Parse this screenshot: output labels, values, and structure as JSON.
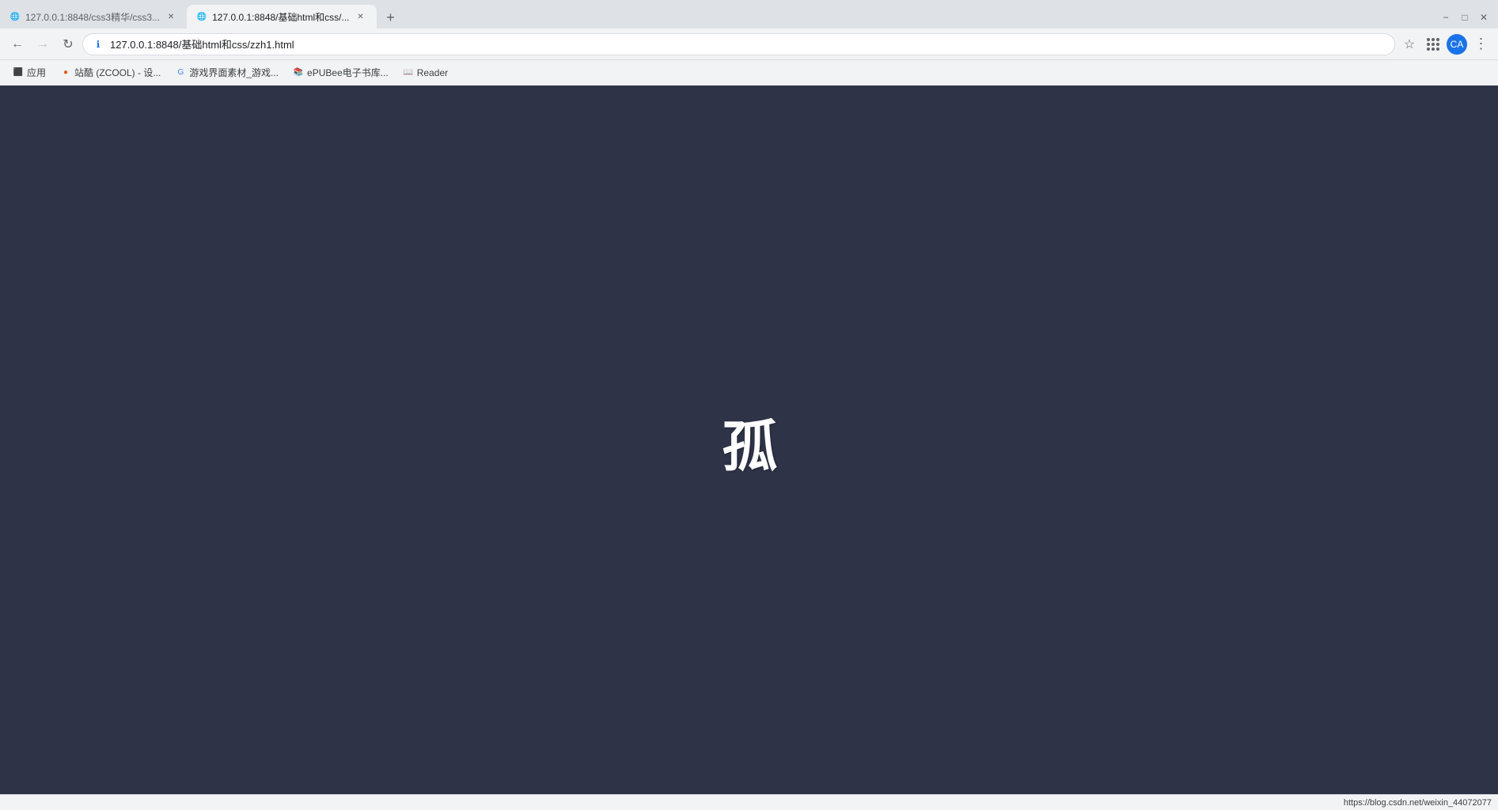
{
  "browser": {
    "tabs": [
      {
        "id": "tab1",
        "title": "127.0.0.1:8848/css3精华/css3...",
        "favicon": "🌐",
        "active": false,
        "url": "127.0.0.1:8848/css3精华/css3"
      },
      {
        "id": "tab2",
        "title": "127.0.0.1:8848/基础html和css/...",
        "favicon": "🌐",
        "active": true,
        "url": "127.0.0.1:8848/基础html和css/zzh1.html"
      }
    ],
    "new_tab_label": "+",
    "window_controls": {
      "minimize": "−",
      "maximize": "□",
      "close": "✕"
    }
  },
  "navbar": {
    "back_disabled": false,
    "forward_disabled": true,
    "reload_label": "↻",
    "address": "127.0.0.1:8848/基础html和css/zzh1.html",
    "address_icon": "ℹ",
    "star_label": "☆"
  },
  "bookmarks": [
    {
      "id": "bm1",
      "label": "应用",
      "favicon": "⬛"
    },
    {
      "id": "bm2",
      "label": "站酷 (ZCOOL) - 设...",
      "favicon": "🔴"
    },
    {
      "id": "bm3",
      "label": "游戏界面素材_游戏...",
      "favicon": "🟢"
    },
    {
      "id": "bm4",
      "label": "ePUBee电子书库...",
      "favicon": "📚"
    },
    {
      "id": "bm5",
      "label": "Reader",
      "favicon": "📖"
    }
  ],
  "page": {
    "background_color": "#2e3347",
    "center_character": "孤",
    "character_color": "#ffffff"
  },
  "status_bar": {
    "url": "https://blog.csdn.net/weixin_44072077"
  },
  "avatar": {
    "initials": "CA"
  }
}
